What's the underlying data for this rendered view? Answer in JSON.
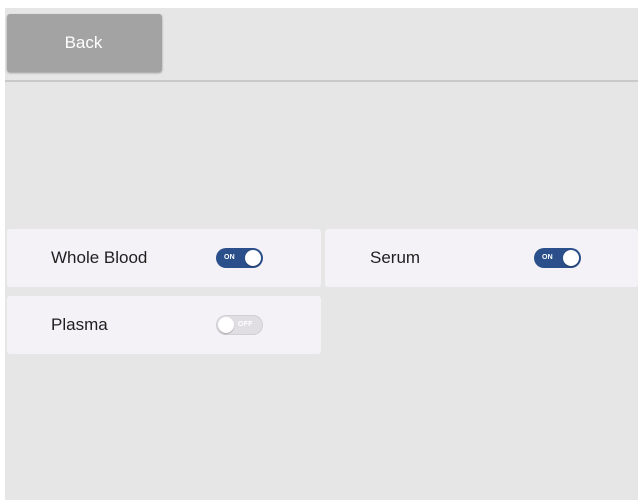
{
  "header": {
    "back_label": "Back"
  },
  "options": [
    {
      "label": "Whole Blood",
      "state": "ON",
      "enabled": true
    },
    {
      "label": "Serum",
      "state": "ON",
      "enabled": true
    },
    {
      "label": "Plasma",
      "state": "OFF",
      "enabled": false
    }
  ],
  "colors": {
    "screen_background": "#e6e6e6",
    "back_button": "#a3a3a3",
    "card_background": "#f4f2f6",
    "toggle_on": "#2b4f8a",
    "toggle_off": "#e0dee3"
  }
}
